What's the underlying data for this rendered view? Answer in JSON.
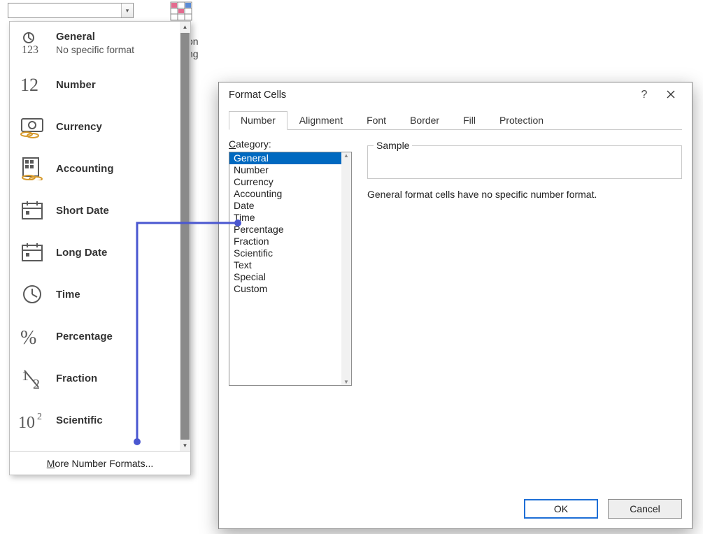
{
  "ribbon": {
    "snippet_line1": "on",
    "snippet_line2": "ng"
  },
  "dropdown": {
    "items": [
      {
        "title": "General",
        "sub": "No specific format",
        "icon": "general"
      },
      {
        "title": "Number",
        "icon": "number"
      },
      {
        "title": "Currency",
        "icon": "currency"
      },
      {
        "title": "Accounting",
        "icon": "accounting"
      },
      {
        "title": "Short Date",
        "icon": "shortdate"
      },
      {
        "title": "Long Date",
        "icon": "longdate"
      },
      {
        "title": "Time",
        "icon": "time"
      },
      {
        "title": "Percentage",
        "icon": "percentage"
      },
      {
        "title": "Fraction",
        "icon": "fraction"
      },
      {
        "title": "Scientific",
        "icon": "scientific"
      }
    ],
    "more": "More Number Formats..."
  },
  "dialog": {
    "title": "Format Cells",
    "tabs": [
      "Number",
      "Alignment",
      "Font",
      "Border",
      "Fill",
      "Protection"
    ],
    "active_tab": 0,
    "category_label": "Category:",
    "categories": [
      "General",
      "Number",
      "Currency",
      "Accounting",
      "Date",
      "Time",
      "Percentage",
      "Fraction",
      "Scientific",
      "Text",
      "Special",
      "Custom"
    ],
    "selected_category": 0,
    "sample_label": "Sample",
    "description": "General format cells have no specific number format.",
    "ok": "OK",
    "cancel": "Cancel"
  }
}
